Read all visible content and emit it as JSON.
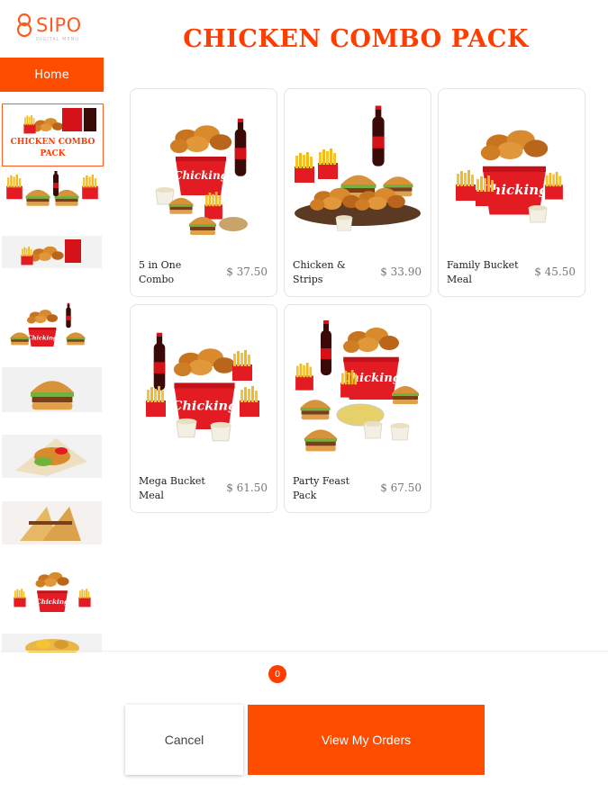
{
  "brand": {
    "name": "SIPO",
    "tagline": "DIGITAL MENU",
    "accent": "#ff4d00"
  },
  "sidebar": {
    "home_label": "Home",
    "items": [
      {
        "label": "CHICKEN COMBO PACK",
        "icon": "combo-thumbnail"
      },
      {
        "label": "",
        "icon": "burger-meal-thumbnail"
      },
      {
        "label": "",
        "icon": "bucket-combo-thumbnail"
      },
      {
        "label": "",
        "icon": "family-meal-thumbnail"
      },
      {
        "label": "",
        "icon": "burger-thumbnail"
      },
      {
        "label": "",
        "icon": "wrap-thumbnail"
      },
      {
        "label": "",
        "icon": "sandwich-thumbnail"
      },
      {
        "label": "",
        "icon": "bucket-thumbnail"
      },
      {
        "label": "",
        "icon": "snack-thumbnail"
      }
    ]
  },
  "page": {
    "title": "CHICKEN COMBO PACK"
  },
  "products": [
    {
      "name": "5 in One Combo",
      "price": "$ 37.50"
    },
    {
      "name": "Chicken & Strips",
      "price": "$ 33.90"
    },
    {
      "name": "Family Bucket Meal",
      "price": "$ 45.50"
    },
    {
      "name": "Mega Bucket Meal",
      "price": "$ 61.50"
    },
    {
      "name": "Party Feast Pack",
      "price": "$ 67.50"
    }
  ],
  "cart": {
    "count": "0"
  },
  "actions": {
    "cancel": "Cancel",
    "view_orders": "View My Orders"
  }
}
